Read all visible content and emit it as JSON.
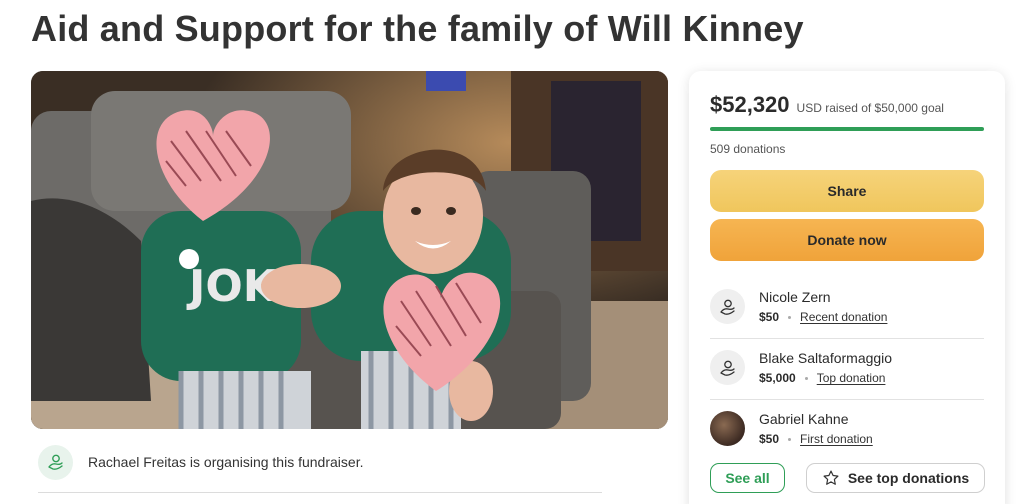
{
  "page": {
    "title": "Aid and Support for the family of Will Kinney"
  },
  "hero": {
    "sweater_letters": "JOK"
  },
  "organizer": {
    "text": "Rachael Freitas is organising this fundraiser.",
    "icon": "person-hand-icon"
  },
  "card": {
    "raised_amount": "$52,320",
    "raised_text": "USD raised of $50,000 goal",
    "progress_fraction": 1.0,
    "donation_count": "509 donations",
    "share_label": "Share",
    "donate_label": "Donate now",
    "donors": [
      {
        "name": "Nicole Zern",
        "amount": "$50",
        "tag": "Recent donation",
        "avatar": "person-hand-icon"
      },
      {
        "name": "Blake Saltaformaggio",
        "amount": "$5,000",
        "tag": "Top donation",
        "avatar": "person-hand-icon"
      },
      {
        "name": "Gabriel Kahne",
        "amount": "$50",
        "tag": "First donation",
        "avatar": "photo"
      }
    ],
    "see_all_label": "See all",
    "see_top_label": "See top donations"
  },
  "colors": {
    "accent_green": "#2f9e57",
    "share_yellow": "#f2c860",
    "donate_orange": "#f2a940"
  }
}
